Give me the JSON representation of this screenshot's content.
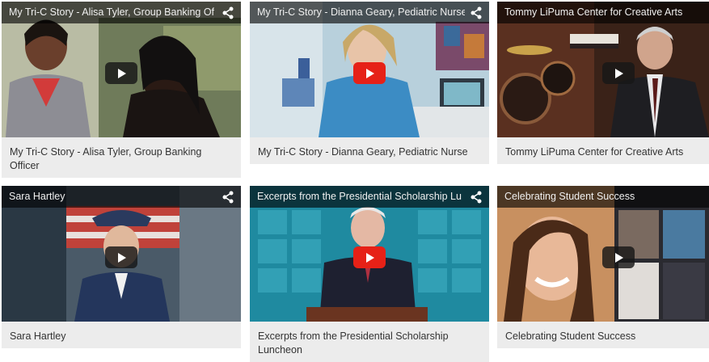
{
  "videos": [
    {
      "overlay_title": "My Tri-C Story - Alisa Tyler, Group Banking Of",
      "caption": "My Tri-C Story - Alisa Tyler, Group Banking Officer",
      "play_style": "dark",
      "share_icon": "share-icon",
      "play_icon": "play-icon"
    },
    {
      "overlay_title": "My Tri-C Story - Dianna Geary, Pediatric Nurse",
      "caption": "My Tri-C Story - Dianna Geary, Pediatric Nurse",
      "play_style": "red",
      "share_icon": "share-icon",
      "play_icon": "play-icon"
    },
    {
      "overlay_title": "Tommy LiPuma Center for Creative Arts",
      "caption": "Tommy LiPuma Center for Creative Arts",
      "play_style": "dark",
      "share_icon": "share-icon",
      "play_icon": "play-icon"
    },
    {
      "overlay_title": "Sara Hartley",
      "caption": "Sara Hartley",
      "play_style": "dark",
      "share_icon": "share-icon",
      "play_icon": "play-icon"
    },
    {
      "overlay_title": "Excerpts from the Presidential Scholarship Lu",
      "caption": "Excerpts from the Presidential Scholarship Luncheon",
      "play_style": "red",
      "share_icon": "share-icon",
      "play_icon": "play-icon"
    },
    {
      "overlay_title": "Celebrating Student Success",
      "caption": "Celebrating Student Success",
      "play_style": "dark",
      "share_icon": "share-icon",
      "play_icon": "play-icon"
    }
  ],
  "colors": {
    "caption_bg": "#ececec",
    "overlay_bg": "#000000",
    "youtube_red": "#e62117"
  }
}
